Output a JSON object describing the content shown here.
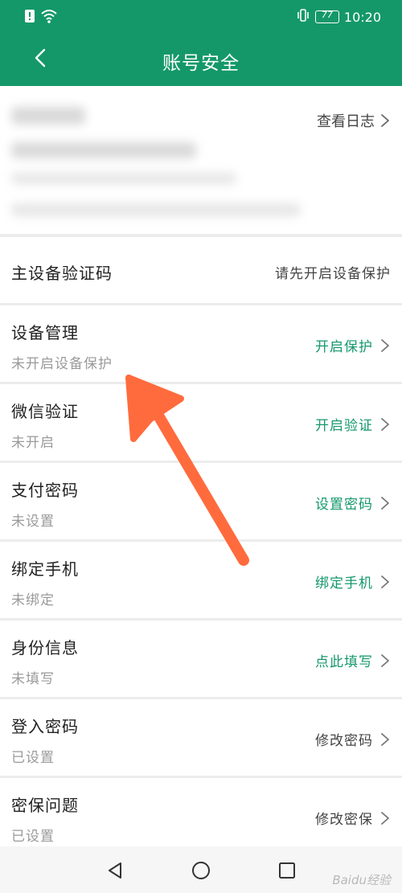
{
  "status_bar": {
    "battery": "77",
    "time": "10:20"
  },
  "header": {
    "title": "账号安全"
  },
  "account_card": {
    "log_link_label": "查看日志"
  },
  "settings": {
    "main_device_code": {
      "label": "主设备验证码",
      "action": "请先开启设备保护"
    },
    "items": [
      {
        "label": "设备管理",
        "status": "未开启设备保护",
        "action": "开启保护"
      },
      {
        "label": "微信验证",
        "status": "未开启",
        "action": "开启验证"
      },
      {
        "label": "支付密码",
        "status": "未设置",
        "action": "设置密码"
      },
      {
        "label": "绑定手机",
        "status": "未绑定",
        "action": "绑定手机"
      },
      {
        "label": "身份信息",
        "status": "未填写",
        "action": "点此填写"
      },
      {
        "label": "登入密码",
        "status": "已设置",
        "action": "修改密码"
      },
      {
        "label": "密保问题",
        "status": "已设置",
        "action": "修改密保"
      }
    ]
  },
  "watermark": "Baidu经验",
  "colors": {
    "brand_green": "#14986a",
    "annotation_arrow": "#ff6b3d"
  }
}
